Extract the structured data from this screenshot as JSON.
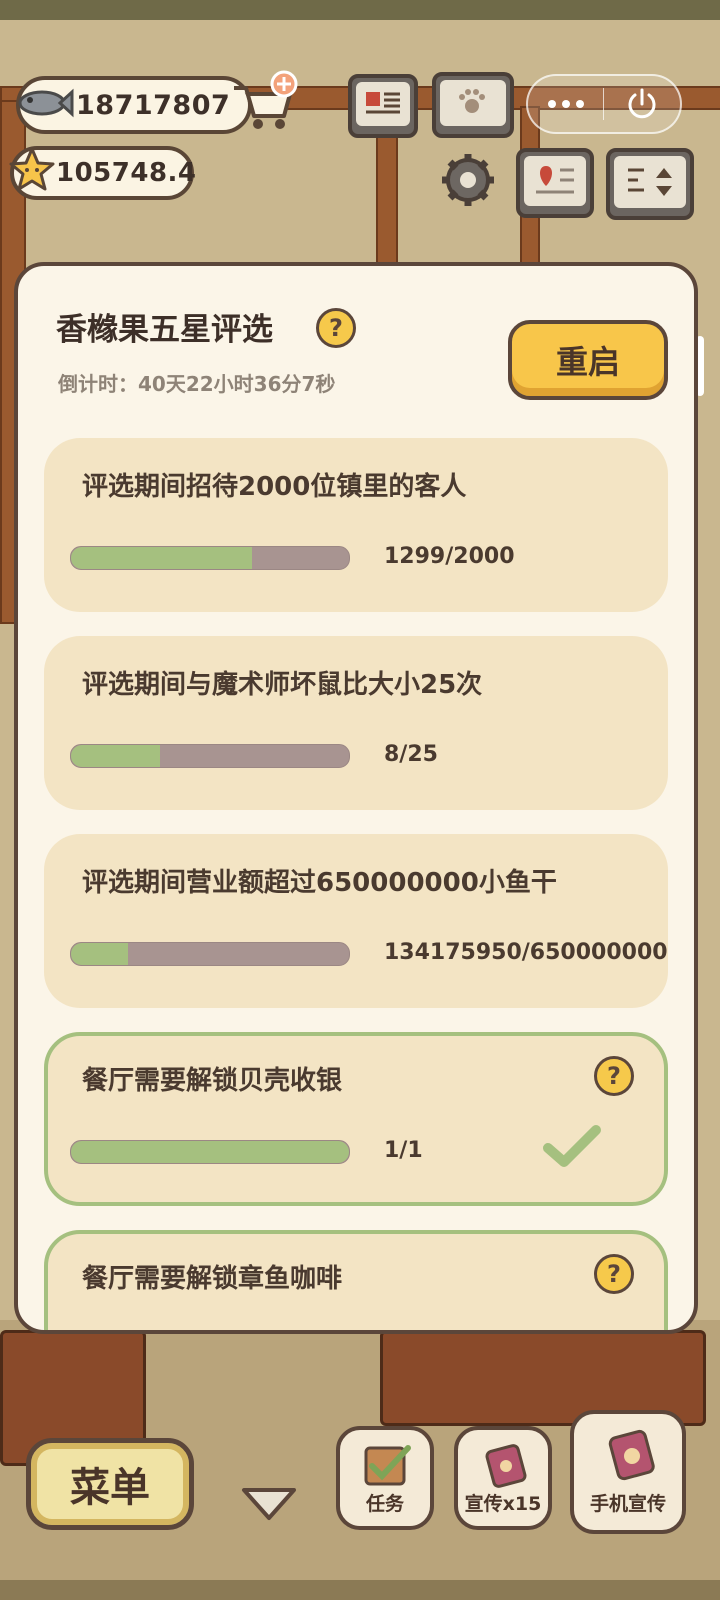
{
  "hud": {
    "fish_count": "18717807",
    "star_count": "105748.4"
  },
  "modal": {
    "title": "香橼果五星评选",
    "countdown": "倒计时：40天22小时36分7秒",
    "restart_label": "重启",
    "help_symbol": "?",
    "tasks": [
      {
        "text": "评选期间招待2000位镇里的客人",
        "progress": "1299/2000",
        "fraction": 0.6495
      },
      {
        "text": "评选期间与魔术师坏鼠比大小25次",
        "progress": "8/25",
        "fraction": 0.32
      },
      {
        "text": "评选期间营业额超过650000000小鱼干",
        "progress": "134175950/650000000",
        "fraction": 0.2064
      },
      {
        "text": "餐厅需要解锁贝壳收银",
        "progress": "1/1",
        "fraction": 1.0,
        "completed": true
      },
      {
        "text": "餐厅需要解锁章鱼咖啡"
      }
    ]
  },
  "bottom": {
    "menu_label": "菜单",
    "task_label": "任务",
    "promo_label": "宣传x15",
    "phone_promo_label": "手机宣传"
  },
  "colors": {
    "progress_fill": "#a5c07f",
    "progress_track": "#a89491",
    "accent_yellow": "#f8c64a",
    "border_brown": "#5b463a"
  }
}
